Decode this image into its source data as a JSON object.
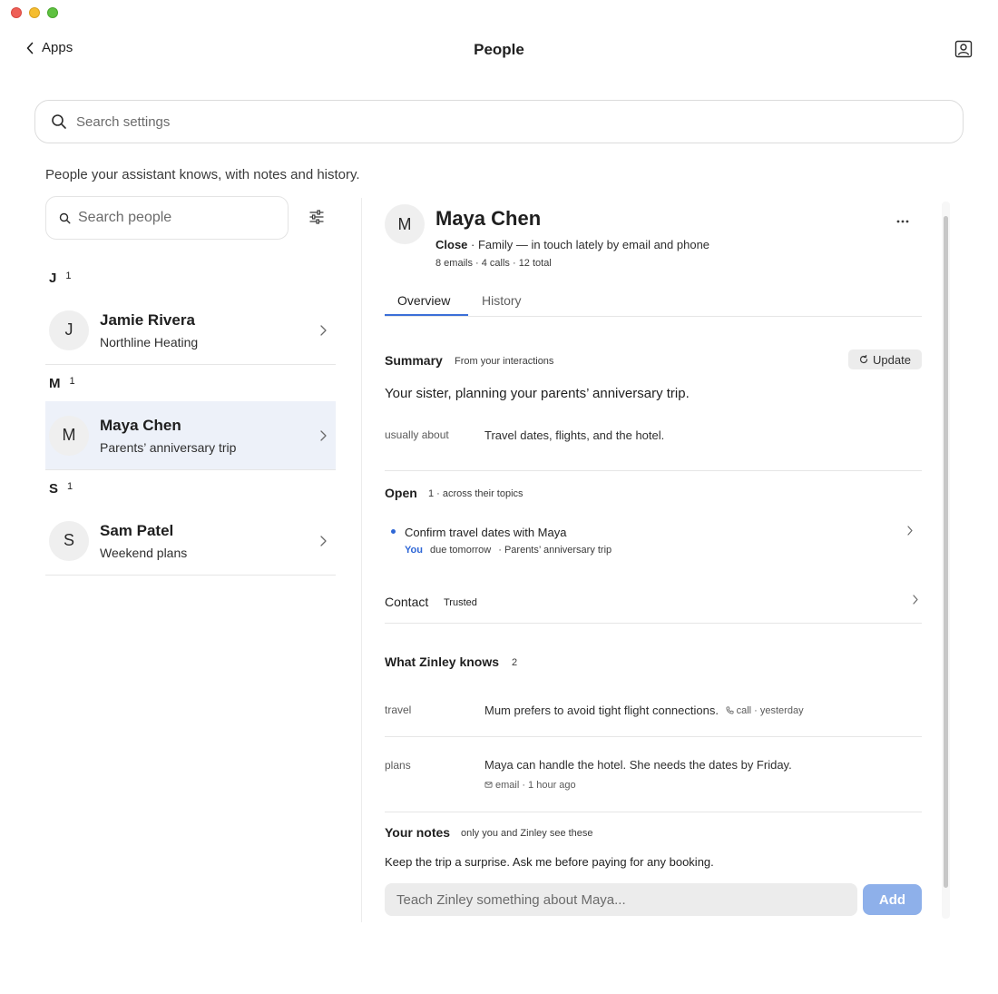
{
  "window": {
    "controls": [
      "close",
      "minimize",
      "maximize"
    ]
  },
  "header": {
    "back_label": "Apps",
    "title": "People"
  },
  "settings_search": {
    "placeholder": "Search settings"
  },
  "subtitle": "People your assistant knows, with notes and history.",
  "people_list": {
    "search_placeholder": "Search people",
    "groups": [
      {
        "letter": "J",
        "count": "1",
        "people": [
          {
            "initial": "J",
            "name": "Jamie Rivera",
            "subtitle": "Northline Heating",
            "selected": false
          }
        ]
      },
      {
        "letter": "M",
        "count": "1",
        "people": [
          {
            "initial": "M",
            "name": "Maya Chen",
            "subtitle": "Parents’ anniversary trip",
            "selected": true
          }
        ]
      },
      {
        "letter": "S",
        "count": "1",
        "people": [
          {
            "initial": "S",
            "name": "Sam Patel",
            "subtitle": "Weekend plans",
            "selected": false
          }
        ]
      }
    ]
  },
  "detail": {
    "initial": "M",
    "name": "Maya Chen",
    "closeness": "Close",
    "relationship": " · Family — in touch lately by email and phone",
    "stats": "8 emails · 4 calls · 12 total",
    "tabs": [
      {
        "label": "Overview",
        "active": true
      },
      {
        "label": "History",
        "active": false
      }
    ],
    "summary": {
      "title": "Summary",
      "note": "From your interactions",
      "update_label": "Update",
      "text": "Your sister, planning your parents’ anniversary trip.",
      "key": "usually about",
      "value": "Travel dates, flights, and the hotel."
    },
    "open": {
      "title": "Open",
      "note": "1 · across their topics",
      "task": {
        "title": "Confirm travel dates with Maya",
        "owner": "You",
        "due": "due tomorrow",
        "topic": "· Parents’ anniversary trip"
      }
    },
    "contact": {
      "title": "Contact",
      "badge": "Trusted"
    },
    "knows": {
      "title": "What Zinley knows",
      "count": "2",
      "facts": [
        {
          "key": "travel",
          "text": "Mum prefers to avoid tight flight connections.",
          "source_icon": "phone-icon",
          "source": "call · yesterday"
        },
        {
          "key": "plans",
          "text": "Maya can handle the hotel. She needs the dates by Friday.",
          "source_icon": "mail-icon",
          "source": "email · 1 hour ago"
        }
      ]
    },
    "notes": {
      "title": "Your notes",
      "note": "only you and Zinley see these",
      "text": "Keep the trip a surprise. Ask me before paying for any booking.",
      "input_placeholder": "Teach Zinley something about Maya...",
      "add_label": "Add"
    }
  },
  "colors": {
    "accent": "#3b6fd8",
    "task_owner": "#2f67d6",
    "selected_row": "#edf1f9",
    "add_button": "#8eb0ea"
  }
}
